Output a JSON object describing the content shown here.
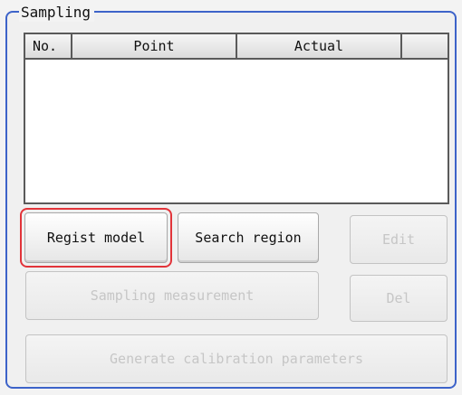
{
  "panel": {
    "title": "Sampling"
  },
  "table": {
    "columns": [
      "No.",
      "Point",
      "Actual",
      ""
    ],
    "rows": []
  },
  "buttons": {
    "regist_model": "Regist model",
    "search_region": "Search region",
    "edit": "Edit",
    "sampling_measurement": "Sampling measurement",
    "del": "Del",
    "generate_calibration": "Generate calibration parameters"
  },
  "colors": {
    "panel_border": "#3d63c9",
    "highlight": "#e2343a",
    "disabled_text": "#c6c6c6"
  }
}
